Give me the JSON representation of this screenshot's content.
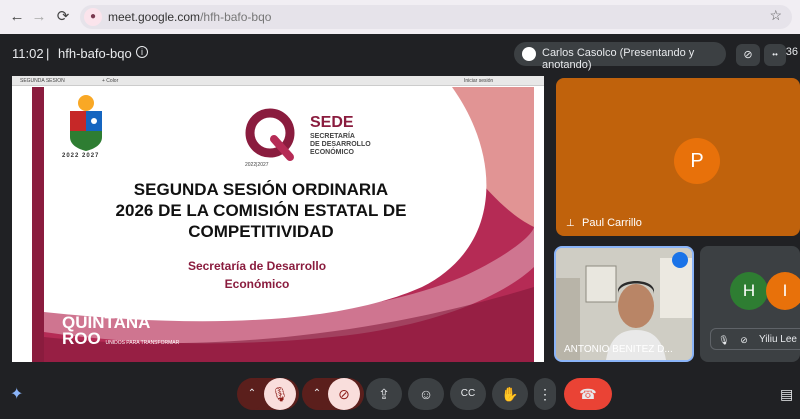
{
  "browser": {
    "url_host": "meet.google.com",
    "url_path": "/hfh-bafo-bqo",
    "back_icon": "arrow-left-icon",
    "forward_icon": "arrow-right-icon",
    "reload_icon": "reload-icon",
    "bookmark_icon": "star-icon"
  },
  "meeting": {
    "time": "11:02",
    "separator": "|",
    "code": "hfh-bafo-bqo",
    "presenter_label": "Carlos Casolco (Presentando y anotando)",
    "participant_count": "36"
  },
  "share_window": {
    "tab_label": "SEGUNDA SESION",
    "new_tab": "+ Color",
    "action": "Iniciar sesión"
  },
  "slide": {
    "crest_years": "2022 2027",
    "sede_title": "SEDE",
    "sede_subtitle_1": "SECRETARÍA",
    "sede_subtitle_2": "DE DESARROLLO",
    "sede_subtitle_3": "ECONÓMICO",
    "sede_years": "2022|2027",
    "title_line_1": "SEGUNDA SESIÓN ORDINARIA",
    "title_line_2": "2026 DE LA COMISIÓN ESTATAL DE",
    "title_line_3": "COMPETITIVIDAD",
    "subtitle_line_1": "Secretaría de Desarrollo",
    "subtitle_line_2": "Económico",
    "logo_line_1": "QUINTANA",
    "logo_line_2": "ROO",
    "logo_tag": "UNIDOS PARA TRANSFORMAR"
  },
  "participants": {
    "paul_initial": "P",
    "paul_name": "Paul Carrillo",
    "antonio_name": "ANTONIO BENITEZ D...",
    "h_initial": "H",
    "i_initial": "I",
    "yliu_name": "Yiliu Lee"
  },
  "colors": {
    "brand": "#8a1c3e",
    "end_call": "#ea4335",
    "paul_tile": "#c0620c"
  }
}
